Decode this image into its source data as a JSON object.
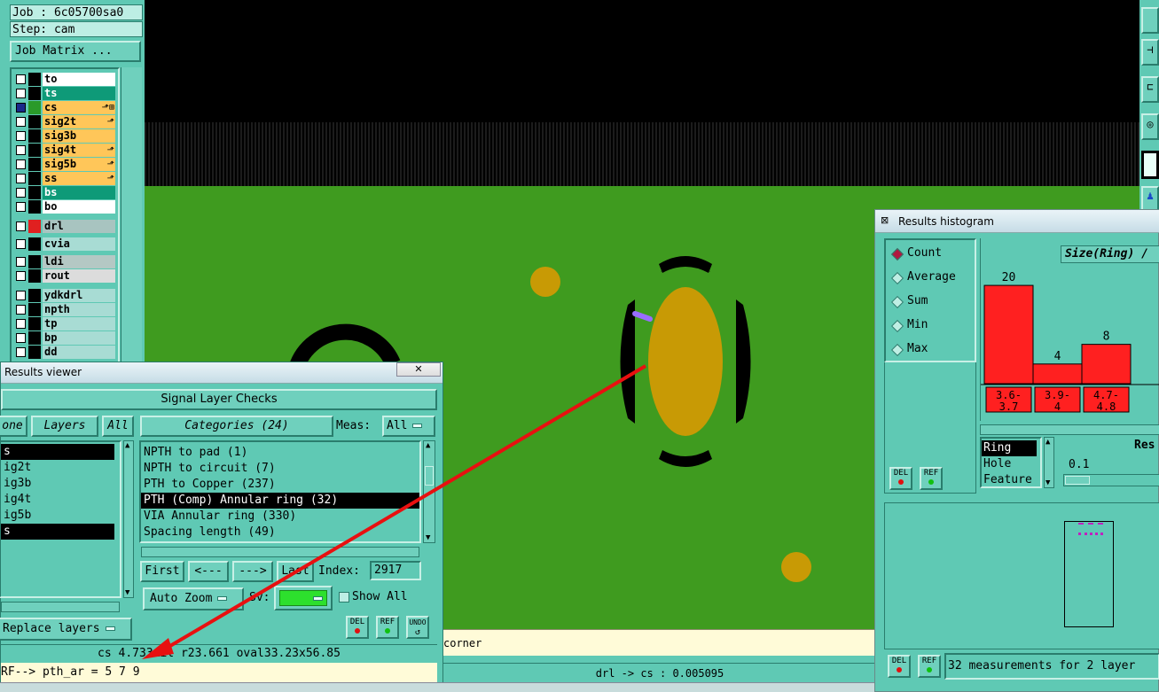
{
  "job_panel": {
    "job": "Job : 6c05700sa0",
    "step": "Step: cam",
    "matrix_button": "Job Matrix ..."
  },
  "layers": [
    {
      "name": "to",
      "color": "#ffffff",
      "swatch": "#000000",
      "flag": ""
    },
    {
      "name": "ts",
      "color": "#0e9a78",
      "swatch": "#000000",
      "flag": ""
    },
    {
      "name": "cs",
      "color": "#ffc659",
      "swatch": "#2a9a2a",
      "flag": "⬏⊞",
      "active": true
    },
    {
      "name": "sig2t",
      "color": "#ffc659",
      "swatch": "#000000",
      "flag": "⬏"
    },
    {
      "name": "sig3b",
      "color": "#ffc659",
      "swatch": "#000000",
      "flag": ""
    },
    {
      "name": "sig4t",
      "color": "#ffc659",
      "swatch": "#000000",
      "flag": "⬏"
    },
    {
      "name": "sig5b",
      "color": "#ffc659",
      "swatch": "#000000",
      "flag": "⬏"
    },
    {
      "name": "ss",
      "color": "#ffc659",
      "swatch": "#000000",
      "flag": "⬏"
    },
    {
      "name": "bs",
      "color": "#0e9a78",
      "swatch": "#000000",
      "flag": ""
    },
    {
      "name": "bo",
      "color": "#ffffff",
      "swatch": "#000000",
      "flag": ""
    },
    {
      "name": "drl",
      "color": "#a8c4c0",
      "swatch": "#e02020",
      "flag": ""
    },
    {
      "name": "cvia",
      "color": "#a8dcd4",
      "swatch": "#000000",
      "flag": ""
    },
    {
      "name": "ldi",
      "color": "#b4c8c4",
      "swatch": "#000000",
      "flag": ""
    },
    {
      "name": "rout",
      "color": "#dcdcdc",
      "swatch": "#000000",
      "flag": ""
    },
    {
      "name": "ydkdrl",
      "color": "#a8dcd4",
      "swatch": "#000000",
      "flag": ""
    },
    {
      "name": "npth",
      "color": "#a8dcd4",
      "swatch": "#000000",
      "flag": ""
    },
    {
      "name": "tp",
      "color": "#a8dcd4",
      "swatch": "#000000",
      "flag": ""
    },
    {
      "name": "bp",
      "color": "#a8dcd4",
      "swatch": "#000000",
      "flag": ""
    },
    {
      "name": "dd",
      "color": "#a8dcd4",
      "swatch": "#000000",
      "flag": ""
    }
  ],
  "results_viewer": {
    "title": "Results viewer",
    "section": "Signal Layer Checks",
    "tab_none": "one",
    "tab_layers": "Layers",
    "tab_all": "All",
    "layer_list": [
      "s",
      "ig2t",
      "ig3b",
      "ig4t",
      "ig5b",
      "s"
    ],
    "categories_label": "Categories (24)",
    "meas_label": "Meas:",
    "meas_value": "All",
    "categories": [
      "NPTH to pad (1)",
      "NPTH to circuit (7)",
      "PTH to Copper (237)",
      "PTH (Comp) Annular ring (32)",
      "VIA Annular ring (330)",
      "Spacing length (49)"
    ],
    "selected_category_index": 3,
    "nav_first": "First",
    "nav_prev": "<---",
    "nav_next": "--->",
    "nav_last": "Last",
    "index_label": "Index:",
    "index_value": "2917",
    "auto_zoom": "Auto Zoom",
    "sv_label": "Sv:",
    "show_all": "Show All",
    "replace_layers": "Replace layers",
    "btn_del": "DEL",
    "btn_ref": "REF",
    "btn_undo": "UNDO",
    "measure_line": "cs 4.733mil  r23.661  oval33.23x56.85",
    "ref_line": "RF--> pth_ar = 5 7 9"
  },
  "status_bar": {
    "corner_text": "corner",
    "measure_text": "drl -> cs : 0.005095"
  },
  "histogram": {
    "title": "Results histogram",
    "modes": [
      "Count",
      "Average",
      "Sum",
      "Min",
      "Max"
    ],
    "selected_mode": "Count",
    "chart_title": "Size(Ring) /",
    "attributes": [
      "Ring",
      "Hole",
      "Feature"
    ],
    "selected_attribute": "Ring",
    "resolution_label": "Res",
    "resolution_value": "0.1",
    "btn_del": "DEL",
    "btn_ref": "REF",
    "summary": "32 measurements for 2 layer"
  },
  "chart_data": {
    "type": "bar",
    "title": "Size(Ring) /",
    "categories": [
      "3.6-3.7",
      "3.9-4",
      "4.7-4.8"
    ],
    "category_labels_top": [
      "3.6-",
      "3.9-",
      "4.7-"
    ],
    "category_labels_bottom": [
      "3.7",
      "4",
      "4.8"
    ],
    "values": [
      20,
      4,
      8
    ],
    "ylim": [
      0,
      22
    ],
    "bar_color": "#ff2020"
  },
  "colors": {
    "ui_bg": "#5fc9b4",
    "board_green": "#3f9b1f",
    "pad_gold": "#c89a05",
    "arrow": "#e81010"
  }
}
